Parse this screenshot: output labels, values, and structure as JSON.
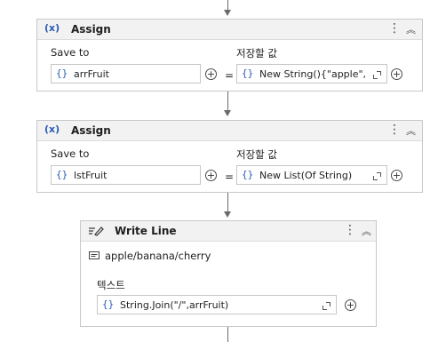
{
  "assign1": {
    "title": "Assign",
    "icon_text": "(x)",
    "save_to_label": "Save to",
    "value_label": "저장할 값",
    "save_to_value": "arrFruit",
    "value_expr": "New String(){\"apple\",",
    "equals": "="
  },
  "assign2": {
    "title": "Assign",
    "icon_text": "(x)",
    "save_to_label": "Save to",
    "value_label": "저장할 값",
    "save_to_value": "lstFruit",
    "value_expr": "New List(Of String)",
    "equals": "="
  },
  "writeline": {
    "title": "Write Line",
    "preview": "apple/banana/cherry",
    "text_label": "텍스트",
    "text_expr": "String.Join(\"/\",arrFruit)"
  },
  "common": {
    "brace": "{}",
    "plus": "+",
    "menu_dots": "⋮",
    "collapse": "︽"
  }
}
